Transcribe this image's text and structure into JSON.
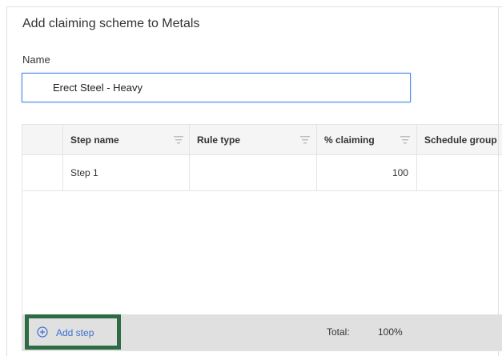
{
  "dialog": {
    "title": "Add claiming scheme to Metals"
  },
  "form": {
    "name_label": "Name",
    "name_value": "Erect Steel - Heavy"
  },
  "grid": {
    "columns": [
      {
        "label": "Step name",
        "filter_icon": "filter-icon"
      },
      {
        "label": "Rule type",
        "filter_icon": "filter-icon"
      },
      {
        "label": "% claiming",
        "filter_icon": "filter-icon"
      },
      {
        "label": "Schedule group"
      }
    ],
    "rows": [
      {
        "step_name": "Step 1",
        "rule_type": "",
        "claiming": "100",
        "schedule_group": ""
      }
    ]
  },
  "footer": {
    "add_step_label": "Add step",
    "add_step_icon": "plus-circle-icon",
    "total_label": "Total:",
    "total_value": "100%"
  },
  "colors": {
    "accent": "#4a86e8",
    "link": "#3b6fd0",
    "highlight_border": "#2d6b45",
    "footer_bg": "#e0e0e0",
    "header_bg": "#f5f5f5"
  }
}
